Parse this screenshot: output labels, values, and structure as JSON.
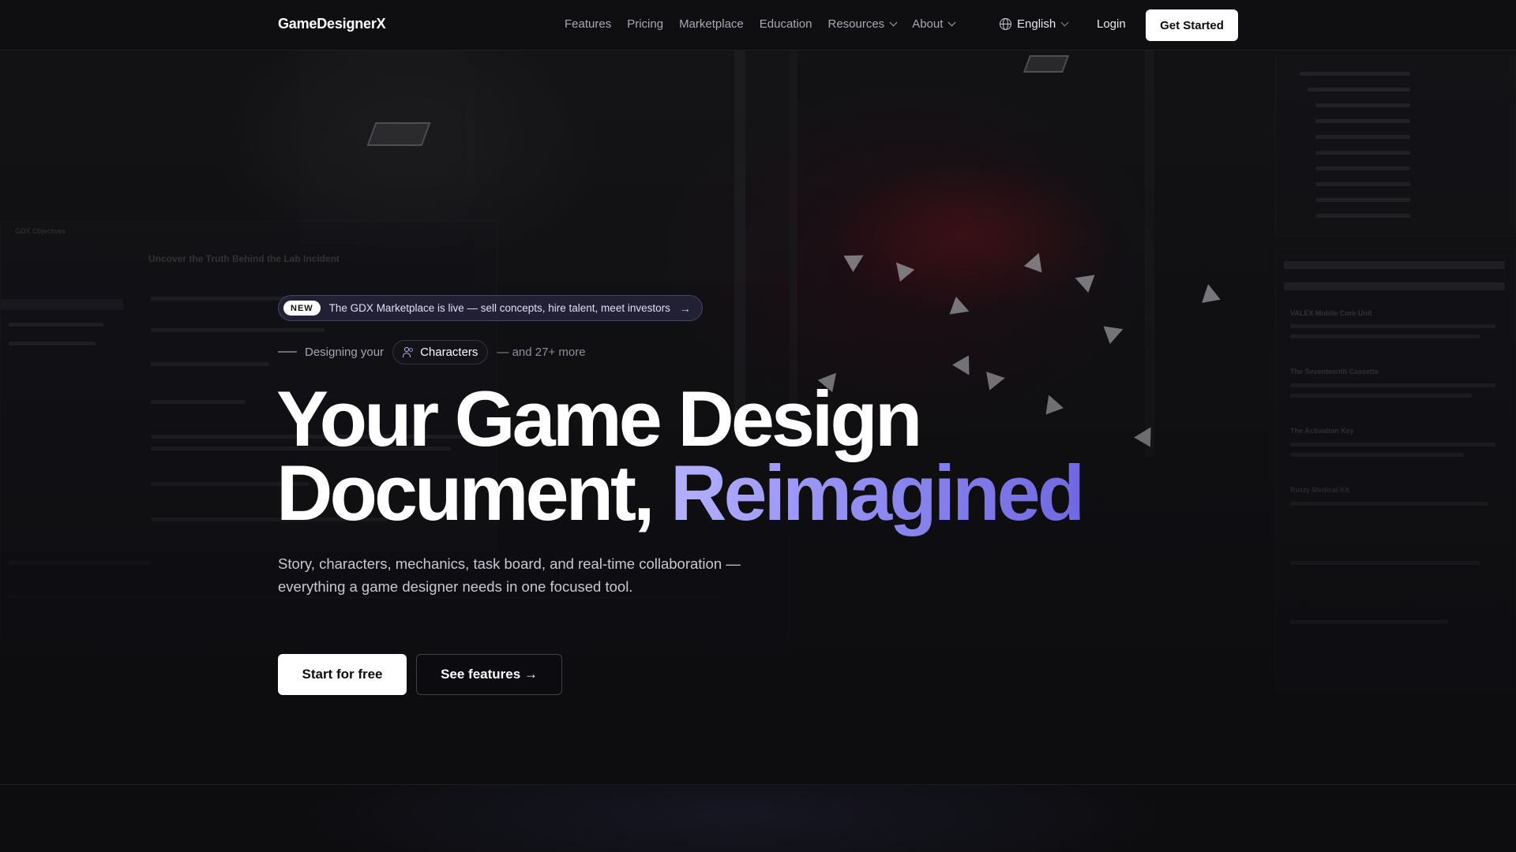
{
  "nav": {
    "brand": "GameDesignerX",
    "links": [
      {
        "label": "Features",
        "dropdown": false
      },
      {
        "label": "Pricing",
        "dropdown": false
      },
      {
        "label": "Marketplace",
        "dropdown": false
      },
      {
        "label": "Education",
        "dropdown": false
      },
      {
        "label": "Resources",
        "dropdown": true
      },
      {
        "label": "About",
        "dropdown": true
      }
    ],
    "language": "English",
    "login": "Login",
    "cta": "Get Started"
  },
  "hero": {
    "announcement": {
      "badge": "NEW",
      "text": "The GDX Marketplace is live — sell concepts, hire talent, meet investors",
      "arrow": "→"
    },
    "designing": {
      "prefix": "Designing your",
      "current": "Characters",
      "suffix": "— and 27+ more"
    },
    "headline": {
      "line1": "Your Game Design",
      "line2_plain": "Document, ",
      "line2_accent": "Reimagined"
    },
    "subhead": "Story, characters, mechanics, task board, and real-time collaboration — everything a game designer needs in one focused tool.",
    "primary_cta": "Start for free",
    "secondary_cta": "See features →"
  },
  "background": {
    "left_panel_title": "Uncover the Truth Behind the Lab Incident",
    "left_panel_tab": "GDX Objectives",
    "right_panel_items": [
      "VALEX Mobile Core Unit",
      "The Seventeenth Cassette",
      "The Activation Key",
      "Rusty Medical Kit"
    ]
  },
  "colors": {
    "background": "#0d0d10",
    "accent_start": "#b4b0ff",
    "accent_end": "#7068e0",
    "text_muted": "#a8a8b3"
  }
}
